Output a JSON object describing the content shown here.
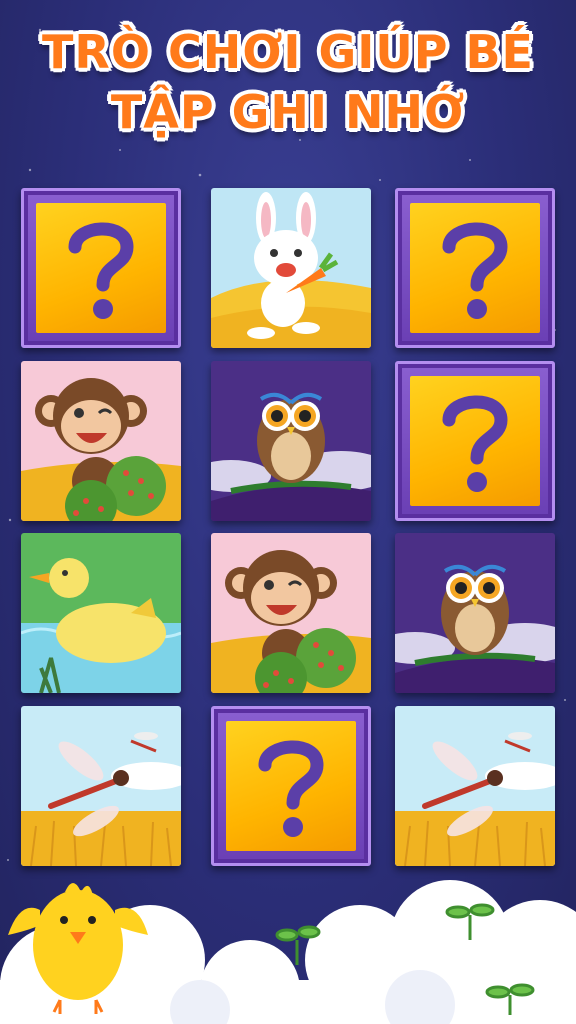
{
  "title": {
    "line1": "TRÒ CHƠI GIÚP BÉ",
    "line2": "TẬP GHI NHỚ"
  },
  "cards": [
    {
      "row": 1,
      "col": 1,
      "state": "face-down",
      "symbol": "?"
    },
    {
      "row": 1,
      "col": 2,
      "state": "face-up",
      "animal": "rabbit"
    },
    {
      "row": 1,
      "col": 3,
      "state": "face-down",
      "symbol": "?"
    },
    {
      "row": 2,
      "col": 1,
      "state": "face-up",
      "animal": "monkey"
    },
    {
      "row": 2,
      "col": 2,
      "state": "face-up",
      "animal": "owl"
    },
    {
      "row": 2,
      "col": 3,
      "state": "face-down",
      "symbol": "?"
    },
    {
      "row": 3,
      "col": 1,
      "state": "face-up",
      "animal": "duck"
    },
    {
      "row": 3,
      "col": 2,
      "state": "face-up",
      "animal": "monkey"
    },
    {
      "row": 3,
      "col": 3,
      "state": "face-up",
      "animal": "owl"
    },
    {
      "row": 4,
      "col": 1,
      "state": "face-up",
      "animal": "dragonfly"
    },
    {
      "row": 4,
      "col": 2,
      "state": "face-down",
      "symbol": "?"
    },
    {
      "row": 4,
      "col": 3,
      "state": "face-up",
      "animal": "dragonfly"
    }
  ],
  "colors": {
    "title": "#ff7a1a",
    "card_back": "#ffc20e",
    "card_frame": "#7a4cc6",
    "question_mark": "#5b3fa8",
    "background": "#2b2e78"
  },
  "mascot": "yellow-chick"
}
